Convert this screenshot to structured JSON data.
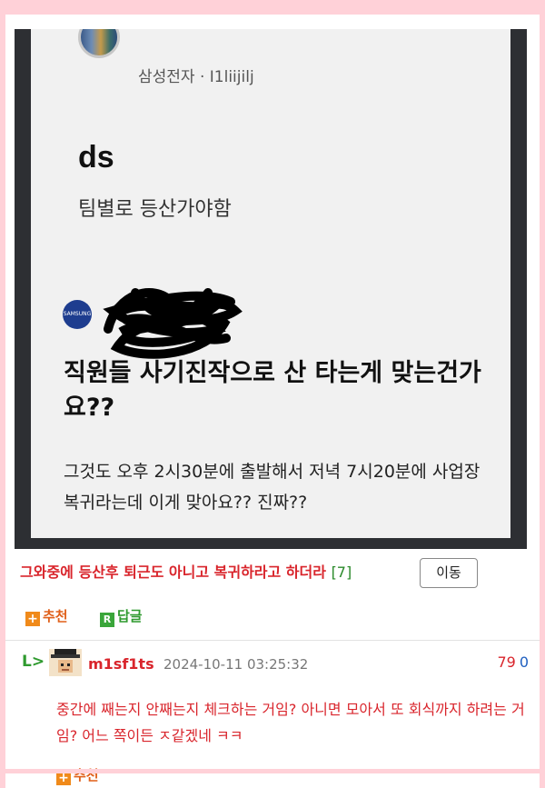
{
  "post_image": {
    "author": "삼성전자 · I1liijilj",
    "title": "ds",
    "subtitle": "팀별로 등산가야함",
    "logo_text": "SAMSUNG",
    "headline": "직원들 사기진작으로 산 타는게 맞는건가요??",
    "body": "그것도 오후 2시30분에 출발해서 저녁 7시20분에 사업장 복귀라는데 이게 맞아요?? 진짜??"
  },
  "post": {
    "title": "그와중에 등산후 퇴근도 아니고 복귀하라고 하더라",
    "comment_count": "[7]",
    "move_button": "이동",
    "recommend_label": "추천",
    "reply_label": "답글"
  },
  "comment": {
    "reply_arrow": "L>",
    "username": "m1sf1ts",
    "date": "2024-10-11 03:25:32",
    "upvotes": "79",
    "downvotes": "0",
    "text": "중간에 째는지 안째는지 체크하는 거임? 아니면 모아서 또 회식까지 하려는 거임? 어느 쪽이든 ㅈ같겠네 ㅋㅋ",
    "recommend_label": "추천"
  },
  "icons": {
    "plus": "+",
    "reply": "R"
  },
  "colors": {
    "accent_red": "#d9252c",
    "recommend_orange": "#e0601a",
    "reply_green": "#2f9a2f",
    "background_pink": "#ffd1d8"
  }
}
